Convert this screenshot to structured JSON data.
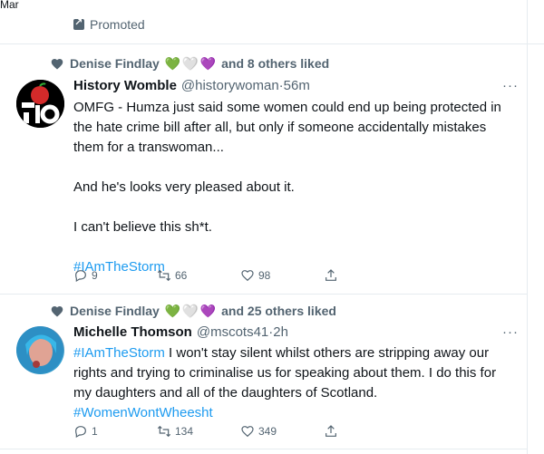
{
  "top_cutoff_text": "Mar",
  "promoted": {
    "label": "Promoted"
  },
  "tweets": [
    {
      "social_context": {
        "name": "Denise Findlay",
        "emojis": [
          "💚",
          "🤍",
          "💜"
        ],
        "suffix": "and 8 others liked"
      },
      "author": {
        "display_name": "History Womble",
        "handle": "@historywoman",
        "time": "56m"
      },
      "more": "···",
      "text": [
        "OMFG - Humza just said some women could end up being protected in the hate crime bill after all, but only if someone accidentally mistakes them for a transwoman...",
        "And he's looks very pleased about it.",
        "I can't believe this sh*t."
      ],
      "hashtag": "#IAmTheStorm",
      "actions": {
        "replies": "9",
        "retweets": "66",
        "likes": "98"
      }
    },
    {
      "social_context": {
        "name": "Denise Findlay",
        "emojis": [
          "💚",
          "🤍",
          "💜"
        ],
        "suffix": "and 25 others liked"
      },
      "author": {
        "display_name": "Michelle Thomson",
        "handle": "@mscots41",
        "time": "2h"
      },
      "more": "···",
      "lead_hashtag": "#IAmTheStorm",
      "text_after_hashtag": " I won't stay silent whilst others are stripping away our rights and trying to criminalise us for speaking about them. I do this for my daughters and all of the daughters of Scotland.",
      "trailing_hashtag": "#WomenWontWheesht",
      "actions": {
        "replies": "1",
        "retweets": "134",
        "likes": "349"
      }
    }
  ],
  "colors": {
    "accent": "#1d9bf0",
    "secondary_text": "#536471",
    "divider": "#e6ecf0"
  }
}
